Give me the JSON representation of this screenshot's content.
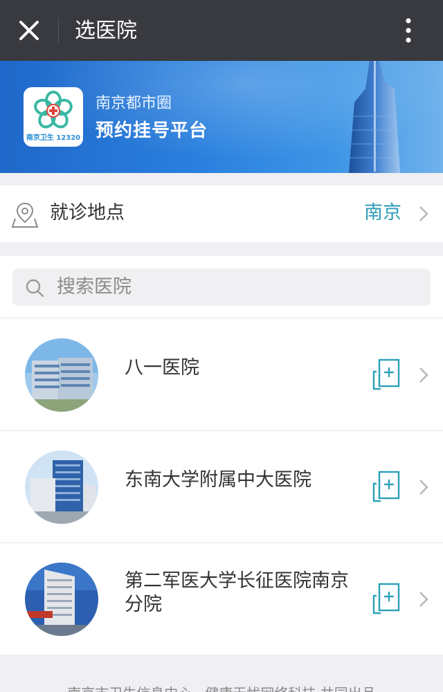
{
  "titlebar": {
    "title": "选医院",
    "close_icon": "close-icon",
    "more_icon": "more-vertical-icon",
    "bg_color": "#393a3f"
  },
  "banner": {
    "logo_caption": "南京卫生 12320",
    "line1": "南京都市圈",
    "line2": "预约挂号平台"
  },
  "location": {
    "icon": "map-pin-icon",
    "label": "就诊地点",
    "value": "南京",
    "accent_color": "#2a9ab4"
  },
  "search": {
    "icon": "search-icon",
    "placeholder": "搜索医院"
  },
  "hospitals": [
    {
      "name": "八一医院",
      "action_icon": "register-icon"
    },
    {
      "name": "东南大学附属中大医院",
      "action_icon": "register-icon"
    },
    {
      "name": "第二军医大学长征医院南京分院",
      "action_icon": "register-icon"
    }
  ],
  "footer": {
    "text": "南京市卫生信息中心 · 健康无忧网络科技 共同出品"
  }
}
